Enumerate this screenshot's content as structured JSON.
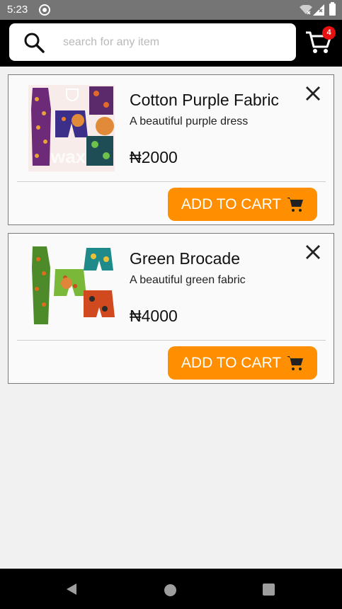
{
  "status_bar": {
    "time": "5:23"
  },
  "header": {
    "search": {
      "placeholder": "search for any item",
      "value": ""
    },
    "cart": {
      "badge_count": "4"
    }
  },
  "products": [
    {
      "title": "Cotton Purple Fabric",
      "description": "A beautiful purple dress",
      "price": "₦2000",
      "add_to_cart_label": "ADD TO CART",
      "image": "purple-ankara-fabric-image"
    },
    {
      "title": "Green Brocade",
      "description": "A beautiful green fabric",
      "price": "₦4000",
      "add_to_cart_label": "ADD TO CART",
      "image": "green-ankara-fabric-image"
    }
  ],
  "colors": {
    "accent": "#ff8f00",
    "badge": "#e81010",
    "header_bg": "#000000",
    "status_bar_bg": "#757575"
  }
}
